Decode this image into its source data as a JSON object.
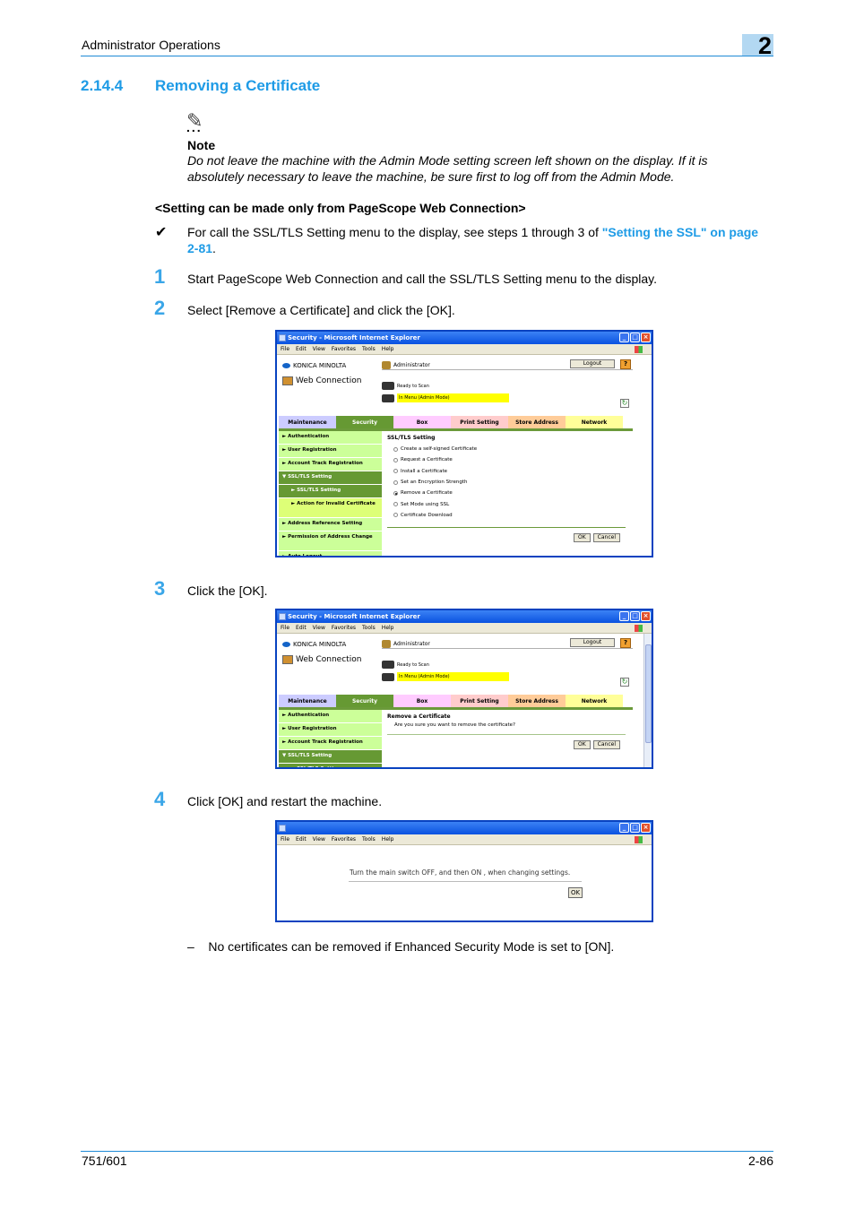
{
  "header": {
    "title": "Administrator Operations",
    "chapter": "2"
  },
  "section": {
    "number": "2.14.4",
    "title": "Removing a Certificate"
  },
  "note": {
    "icon": "pencil-note-icon",
    "dots": "...",
    "label": "Note",
    "text": "Do not leave the machine with the Admin Mode setting screen left shown on the display. If it is absolutely necessary to leave the machine, be sure first to log off from the Admin Mode."
  },
  "setting_heading": "<Setting can be made only from PageScope Web Connection>",
  "prerequisite": {
    "icon": "checkmark-icon",
    "text": "For call the SSL/TLS Setting menu to the display, see steps 1 through 3 of ",
    "link": "\"Setting the SSL\" on page 2-81",
    "suffix": "."
  },
  "steps": [
    {
      "num": "1",
      "text": "Start PageScope Web Connection and call the SSL/TLS Setting menu to the display."
    },
    {
      "num": "2",
      "text": "Select [Remove a Certificate] and click the [OK]."
    },
    {
      "num": "3",
      "text": "Click the [OK]."
    },
    {
      "num": "4",
      "text": "Click [OK] and restart the machine."
    }
  ],
  "dash_note": "No certificates can be removed if Enhanced Security Mode is set to [ON].",
  "browser": {
    "title": "Security - Microsoft Internet Explorer",
    "menu": [
      "File",
      "Edit",
      "View",
      "Favorites",
      "Tools",
      "Help"
    ],
    "brand": "KONICA MINOLTA",
    "product": "Web Connection",
    "user": "Administrator",
    "logout": "Logout",
    "help": "?",
    "status1": "Ready to Scan",
    "status2": "In Menu (Admin Mode)",
    "tabs": [
      "Maintenance",
      "Security",
      "Box",
      "Print Setting",
      "Store Address",
      "Network"
    ],
    "sidebar": [
      "Authentication",
      "User Registration",
      "Account Track Registration",
      "SSL/TLS Setting",
      "SSL/TLS Setting",
      "Action for Invalid Certificate",
      "Address Reference Setting",
      "Permission of Address Change",
      "Auto Logout"
    ],
    "ok": "OK",
    "cancel": "Cancel"
  },
  "screen1": {
    "heading": "SSL/TLS Setting",
    "options": [
      "Create a self-signed Certificate",
      "Request a Certificate",
      "Install a Certificate",
      "Set an Encryption Strength",
      "Remove a Certificate",
      "Set Mode using SSL",
      "Certificate Download"
    ],
    "selected": "Remove a Certificate"
  },
  "screen2": {
    "heading": "Remove a Certificate",
    "message": "Are you sure you want to remove the certificate?"
  },
  "screen3": {
    "message": "Turn the main switch OFF, and then ON , when changing settings.",
    "ok": "OK"
  },
  "footer": {
    "model": "751/601",
    "page": "2-86"
  }
}
